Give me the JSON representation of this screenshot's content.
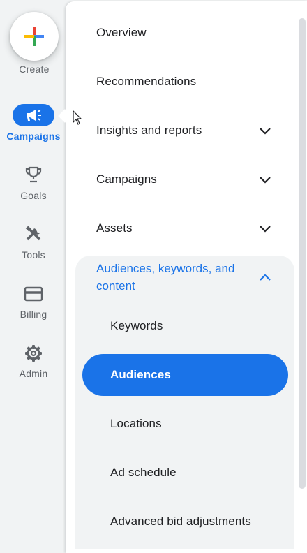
{
  "rail": {
    "create_label": "Create",
    "items": [
      {
        "label": "Campaigns",
        "icon": "megaphone-icon",
        "active": true
      },
      {
        "label": "Goals",
        "icon": "trophy-icon",
        "active": false
      },
      {
        "label": "Tools",
        "icon": "tools-icon",
        "active": false
      },
      {
        "label": "Billing",
        "icon": "credit-card-icon",
        "active": false
      },
      {
        "label": "Admin",
        "icon": "gear-icon",
        "active": false
      }
    ]
  },
  "menu": {
    "items": [
      {
        "label": "Overview",
        "expandable": false
      },
      {
        "label": "Recommendations",
        "expandable": false
      },
      {
        "label": "Insights and reports",
        "expandable": true
      },
      {
        "label": "Campaigns",
        "expandable": true
      },
      {
        "label": "Assets",
        "expandable": true
      }
    ],
    "expanded_group": {
      "label": "Audiences, keywords, and content",
      "children": [
        {
          "label": "Keywords"
        },
        {
          "label": "Audiences",
          "selected": true
        },
        {
          "label": "Locations"
        },
        {
          "label": "Ad schedule"
        },
        {
          "label": "Advanced bid adjustments"
        }
      ]
    }
  },
  "colors": {
    "accent": "#1a73e8",
    "rail_bg": "#f1f3f4",
    "text": "#202124",
    "muted": "#5f6368"
  }
}
